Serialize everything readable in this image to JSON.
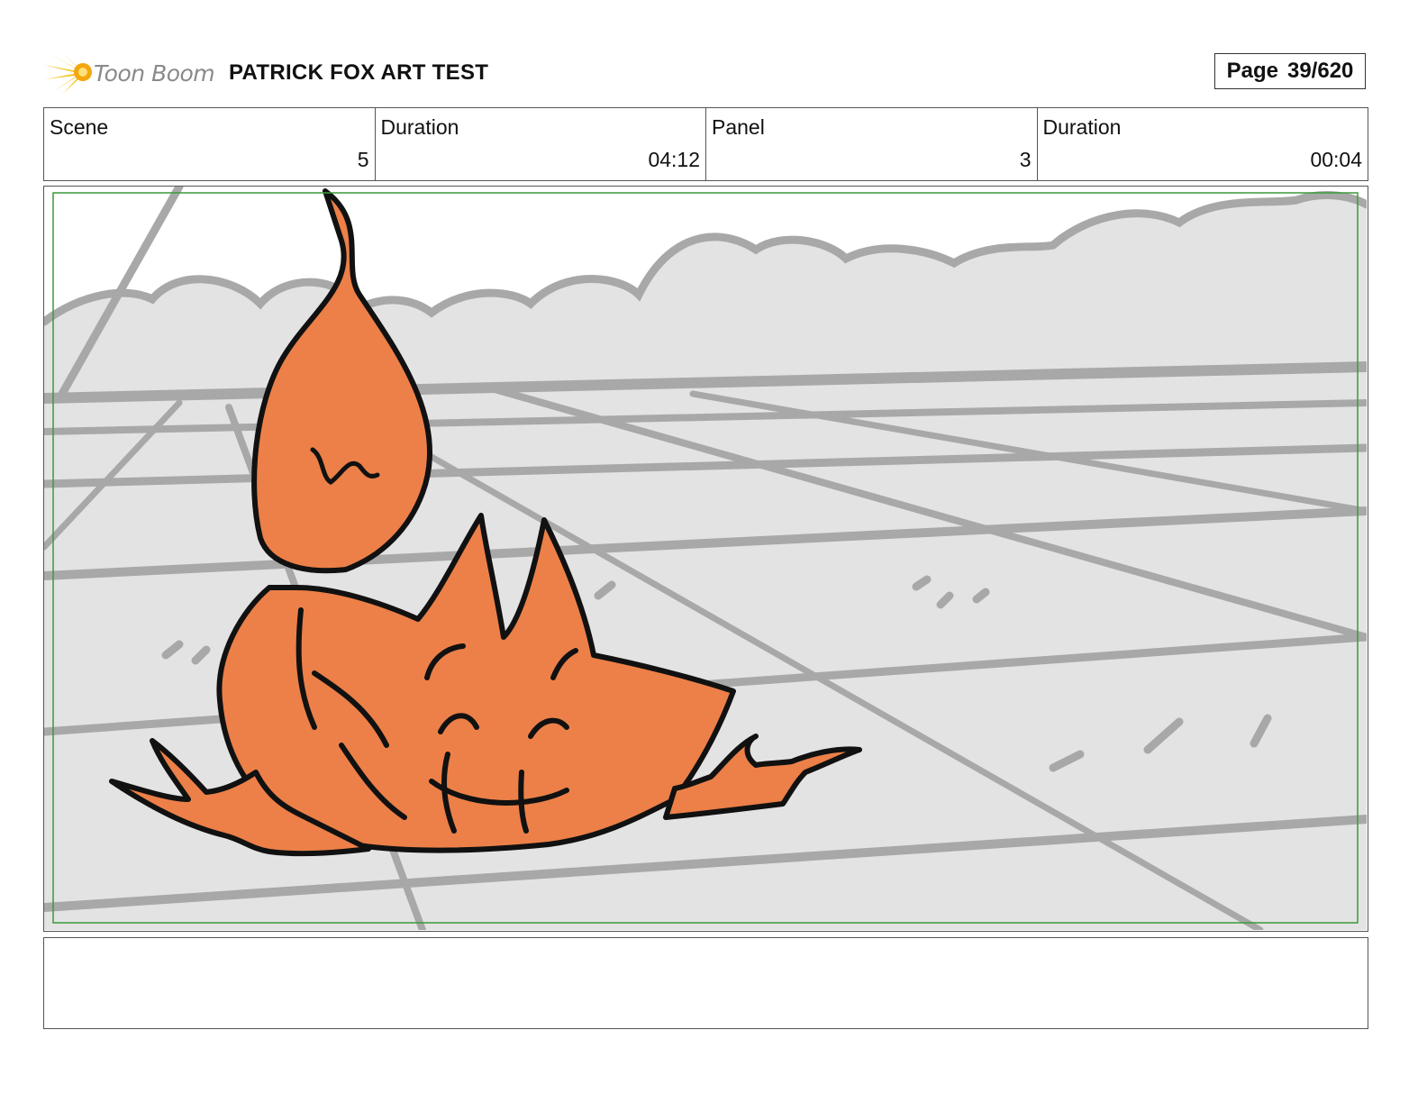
{
  "header": {
    "logo_text": "Toon Boom",
    "project_title": "PATRICK FOX ART TEST",
    "page_label": "Page",
    "page_value": "39/620"
  },
  "info": {
    "scene_label": "Scene",
    "scene_value": "5",
    "scene_duration_label": "Duration",
    "scene_duration_value": "04:12",
    "panel_label": "Panel",
    "panel_value": "3",
    "panel_duration_label": "Duration",
    "panel_duration_value": "00:04"
  },
  "notes": {
    "text": ""
  },
  "colors": {
    "fox_orange": "#ec8048",
    "ground_gray": "#e3e3e3",
    "sketch_gray": "#a8a8a8",
    "safe_frame_green": "#3a9a3a",
    "logo_yellow": "#f6c21c"
  }
}
